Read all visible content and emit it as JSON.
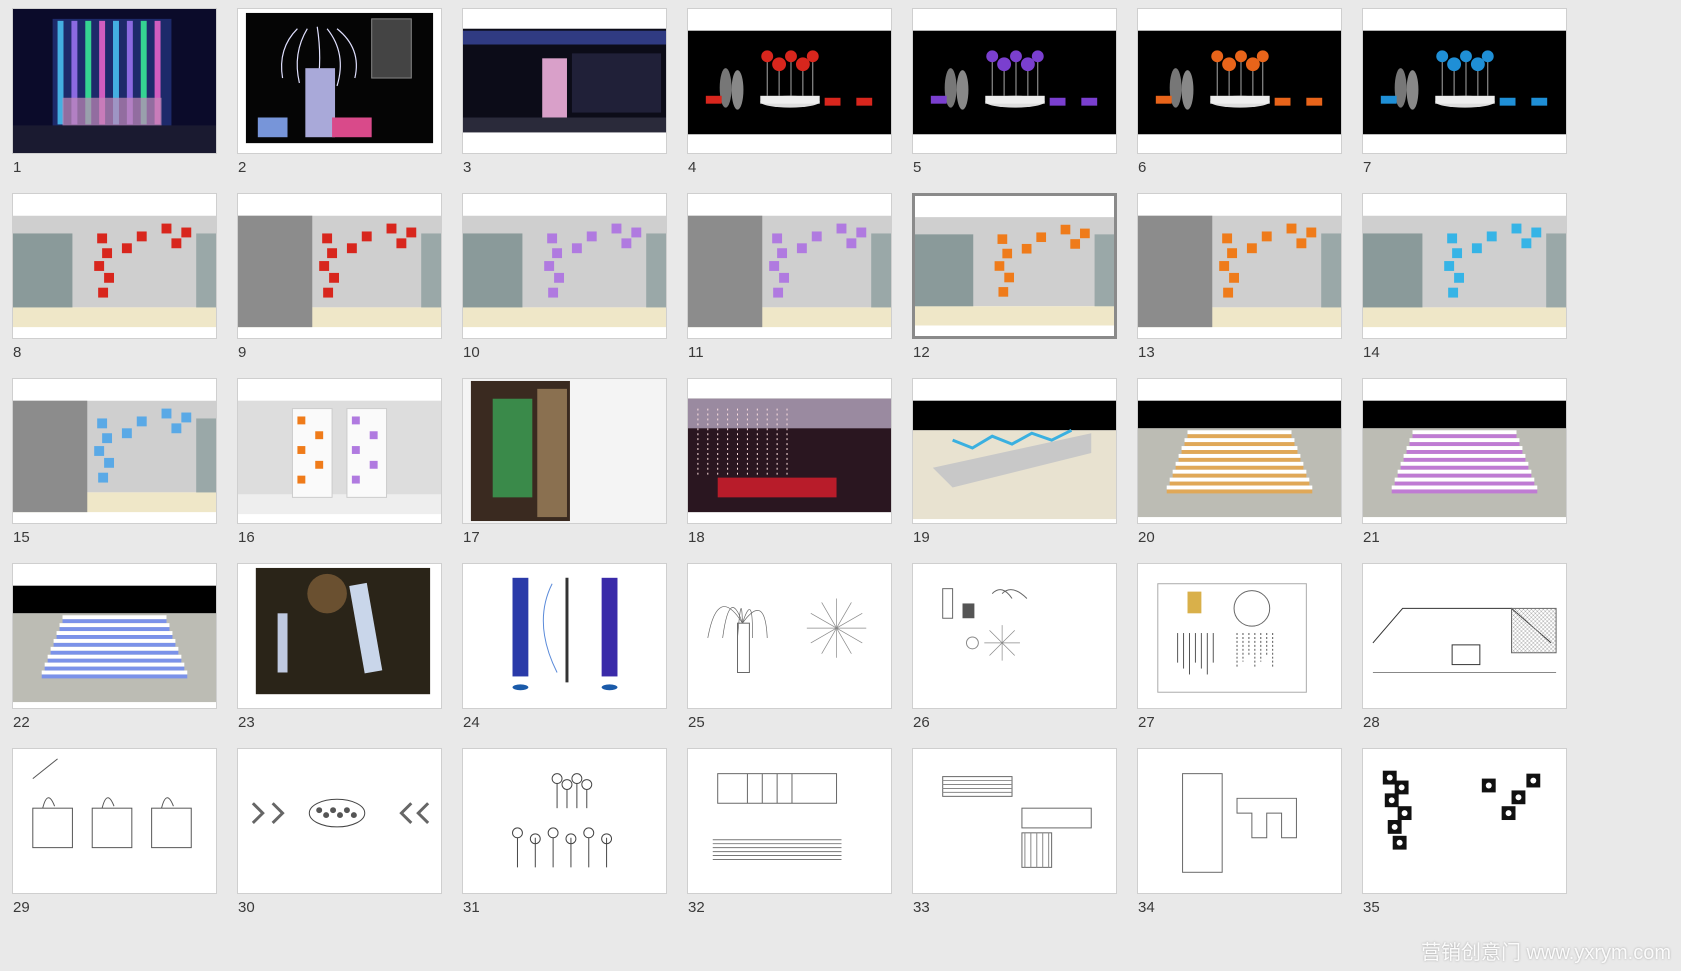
{
  "view": "slide-sorter",
  "selected_slide": "12",
  "watermark": "营销创意门 www.yxrym.com",
  "slides": [
    {
      "number": "1",
      "kind": "night-building"
    },
    {
      "number": "2",
      "kind": "fountain-sheet"
    },
    {
      "number": "3",
      "kind": "night-facade"
    },
    {
      "number": "4",
      "kind": "balloon-stage",
      "accent": "#d8261d"
    },
    {
      "number": "5",
      "kind": "balloon-stage",
      "accent": "#7a3fcf"
    },
    {
      "number": "6",
      "kind": "balloon-stage",
      "accent": "#e8641a"
    },
    {
      "number": "7",
      "kind": "balloon-stage",
      "accent": "#1f8fd6"
    },
    {
      "number": "8",
      "kind": "wall",
      "accent": "#d8261d",
      "sign": false
    },
    {
      "number": "9",
      "kind": "wall",
      "accent": "#d8261d",
      "sign": true
    },
    {
      "number": "10",
      "kind": "wall",
      "accent": "#b07ae0",
      "sign": false
    },
    {
      "number": "11",
      "kind": "wall",
      "accent": "#b07ae0",
      "sign": true
    },
    {
      "number": "12",
      "kind": "wall",
      "accent": "#ef7b1a",
      "sign": false
    },
    {
      "number": "13",
      "kind": "wall",
      "accent": "#ef7b1a",
      "sign": true
    },
    {
      "number": "14",
      "kind": "wall",
      "accent": "#36b4e6",
      "sign": false
    },
    {
      "number": "15",
      "kind": "wall",
      "accent": "#5aa9e6",
      "sign": true
    },
    {
      "number": "16",
      "kind": "pillars"
    },
    {
      "number": "17",
      "kind": "mall-photo"
    },
    {
      "number": "18",
      "kind": "mall-lights"
    },
    {
      "number": "19",
      "kind": "stairs-side"
    },
    {
      "number": "20",
      "kind": "stairs-top",
      "accent": "#f0a030"
    },
    {
      "number": "21",
      "kind": "stairs-top",
      "accent": "#c060e0"
    },
    {
      "number": "22",
      "kind": "stairs-top",
      "accent": "#6080ff"
    },
    {
      "number": "23",
      "kind": "tree-photo"
    },
    {
      "number": "24",
      "kind": "drawing-banners"
    },
    {
      "number": "25",
      "kind": "drawing-fountain"
    },
    {
      "number": "26",
      "kind": "drawing-details"
    },
    {
      "number": "27",
      "kind": "drawing-curtain"
    },
    {
      "number": "28",
      "kind": "drawing-slope"
    },
    {
      "number": "29",
      "kind": "drawing-boxes"
    },
    {
      "number": "30",
      "kind": "drawing-arrows"
    },
    {
      "number": "31",
      "kind": "drawing-trees"
    },
    {
      "number": "32",
      "kind": "drawing-stairs"
    },
    {
      "number": "33",
      "kind": "drawing-plan"
    },
    {
      "number": "34",
      "kind": "drawing-frames"
    },
    {
      "number": "35",
      "kind": "drawing-dots"
    }
  ]
}
